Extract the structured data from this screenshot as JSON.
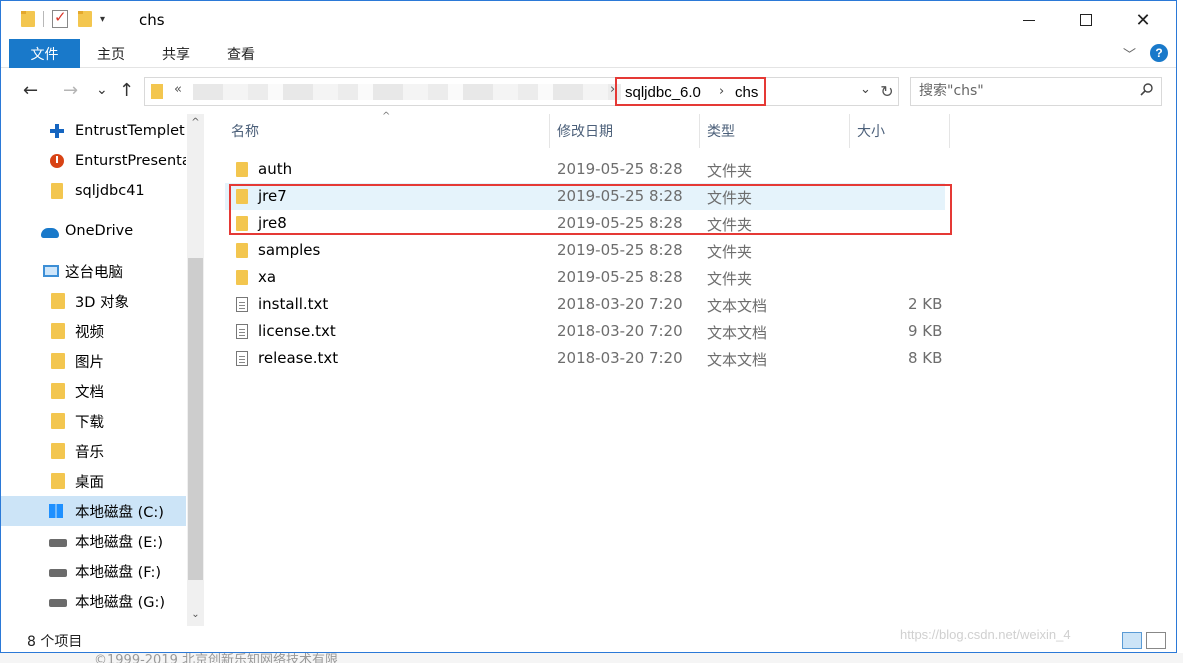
{
  "window": {
    "title": "chs",
    "controls": {
      "minimize": "",
      "maximize": "",
      "close": "✕"
    }
  },
  "ribbon": {
    "file_tab": "文件",
    "tabs": [
      "主页",
      "共享",
      "查看"
    ],
    "help": "?"
  },
  "nav": {
    "back": "←",
    "forward": "→",
    "recent": "⌄",
    "up": "↑",
    "address_prefix": "«",
    "breadcrumb": [
      "sqljdbc_6.0",
      "chs"
    ],
    "breadcrumb_separator": "›",
    "dropdown": "⌄",
    "refresh": "↻",
    "search_placeholder": "搜索\"chs\""
  },
  "sidebar": {
    "items": [
      {
        "label": "EntrustTemplet",
        "icon": "blue-cross-icon"
      },
      {
        "label": "EnturstPresenta",
        "icon": "red-app-icon"
      },
      {
        "label": "sqljdbc41",
        "icon": "folder-icon"
      },
      {
        "label": "OneDrive",
        "icon": "cloud-icon"
      },
      {
        "label": "这台电脑",
        "icon": "computer-icon"
      },
      {
        "label": "3D 对象",
        "icon": "3d-objects-icon"
      },
      {
        "label": "视频",
        "icon": "video-icon"
      },
      {
        "label": "图片",
        "icon": "pictures-icon"
      },
      {
        "label": "文档",
        "icon": "documents-icon"
      },
      {
        "label": "下载",
        "icon": "download-icon"
      },
      {
        "label": "音乐",
        "icon": "music-icon"
      },
      {
        "label": "桌面",
        "icon": "desktop-icon"
      },
      {
        "label": "本地磁盘 (C:)",
        "icon": "windows-drive-icon",
        "selected": true
      },
      {
        "label": "本地磁盘 (E:)",
        "icon": "drive-icon"
      },
      {
        "label": "本地磁盘 (F:)",
        "icon": "drive-icon"
      },
      {
        "label": "本地磁盘 (G:)",
        "icon": "drive-icon"
      }
    ],
    "scroll_up": "^",
    "scroll_down": "⌄"
  },
  "columns": {
    "name": "名称",
    "date": "修改日期",
    "type": "类型",
    "size": "大小",
    "sort_indicator": "^"
  },
  "files": [
    {
      "name": "auth",
      "date": "2019-05-25 8:28",
      "type": "文件夹",
      "size": "",
      "kind": "folder"
    },
    {
      "name": "jre7",
      "date": "2019-05-25 8:28",
      "type": "文件夹",
      "size": "",
      "kind": "folder"
    },
    {
      "name": "jre8",
      "date": "2019-05-25 8:28",
      "type": "文件夹",
      "size": "",
      "kind": "folder"
    },
    {
      "name": "samples",
      "date": "2019-05-25 8:28",
      "type": "文件夹",
      "size": "",
      "kind": "folder"
    },
    {
      "name": "xa",
      "date": "2019-05-25 8:28",
      "type": "文件夹",
      "size": "",
      "kind": "folder"
    },
    {
      "name": "install.txt",
      "date": "2018-03-20 7:20",
      "type": "文本文档",
      "size": "2 KB",
      "kind": "text"
    },
    {
      "name": "license.txt",
      "date": "2018-03-20 7:20",
      "type": "文本文档",
      "size": "9 KB",
      "kind": "text"
    },
    {
      "name": "release.txt",
      "date": "2018-03-20 7:20",
      "type": "文本文档",
      "size": "8 KB",
      "kind": "text"
    }
  ],
  "status": {
    "item_count": "8 个项目"
  },
  "overlay": {
    "watermark": "https://blog.csdn.net/weixin_4",
    "bottom_text": "©1999-2019 北京创新乐知网络技术有限"
  },
  "colors": {
    "accent": "#1979ca",
    "highlight_red": "#e53935",
    "folder": "#f3c64f",
    "selection": "#cce4f7"
  }
}
